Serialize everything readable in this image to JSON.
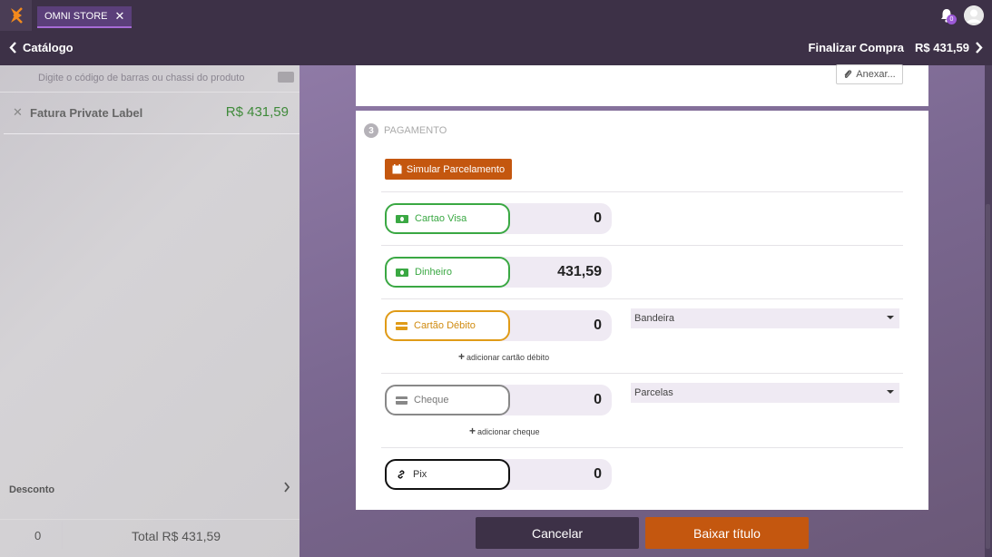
{
  "topbar": {
    "store_tab": "OMNI STORE",
    "close_glyph": "✕",
    "notifications_count": "0"
  },
  "navbar": {
    "back_label": "Catálogo",
    "forward_label": "Finalizar Compra",
    "forward_amount": "R$ 431,59"
  },
  "left": {
    "barcode_placeholder": "Digite o código de barras ou chassi do produto",
    "items": [
      {
        "name": "Fatura Private Label",
        "price": "R$ 431,59"
      }
    ],
    "discount_label": "Desconto",
    "quantity": "0",
    "total": "Total R$ 431,59"
  },
  "attach": {
    "label": "Anexar..."
  },
  "payment": {
    "step_number": "3",
    "step_title": "PAGAMENTO",
    "simulate_label": "Simular Parcelamento",
    "methods": [
      {
        "label": "Cartao Visa",
        "value": "0",
        "icon": "money-icon",
        "color": "#3aa843"
      },
      {
        "label": "Dinheiro",
        "value": "431,59",
        "icon": "money-icon",
        "color": "#3aa843"
      },
      {
        "label": "Cartão Débito",
        "value": "0",
        "icon": "credit-card-icon",
        "color": "#e09b17",
        "add_label": "adicionar cartão débito",
        "select": "Bandeira"
      },
      {
        "label": "Cheque",
        "value": "0",
        "icon": "check-card-icon",
        "color": "#888888",
        "add_label": "adicionar cheque",
        "select": "Parcelas"
      },
      {
        "label": "Pix",
        "value": "0",
        "icon": "link-icon",
        "color": "#111111"
      }
    ]
  },
  "actions": {
    "cancel_label": "Cancelar",
    "confirm_label": "Baixar título"
  },
  "colors": {
    "header_bg": "#3d3147",
    "accent_orange": "#c4570f",
    "accent_purple": "#5b3f7a",
    "price_green": "#3f8a3a"
  }
}
